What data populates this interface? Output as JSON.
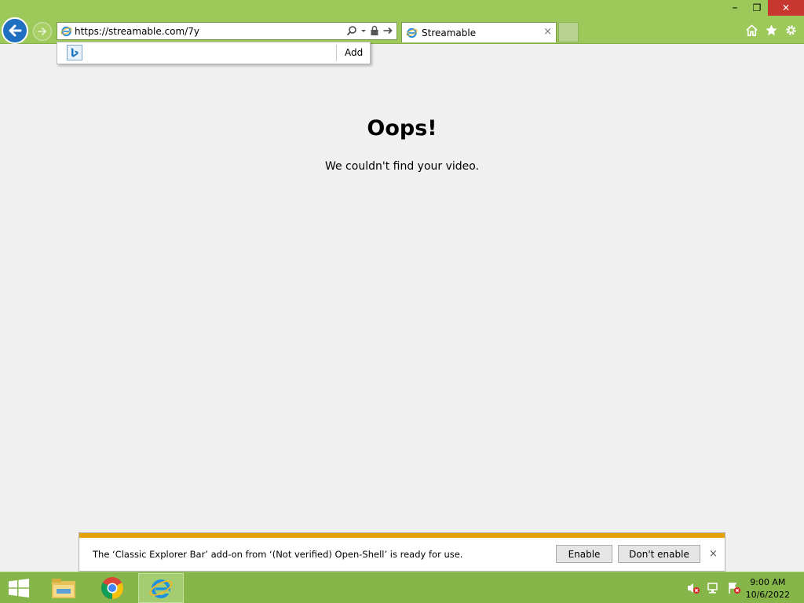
{
  "browser": {
    "address_url": "https://streamable.com/7y",
    "tab_title": "Streamable",
    "tab_close_glyph": "×",
    "suggest_add_label": "Add",
    "icons": [
      "back-icon",
      "forward-icon",
      "ie-icon",
      "search-icon",
      "lock-icon",
      "go-icon",
      "home-icon",
      "favorites-star-icon",
      "settings-gear-icon",
      "bing-icon"
    ]
  },
  "window": {
    "minimize_glyph": "–",
    "restore_glyph": "❐",
    "close_glyph": "✕"
  },
  "content": {
    "heading": "Oops!",
    "message": "We couldn't find your video."
  },
  "notification": {
    "text": "The ‘Classic Explorer Bar’ add-on from ‘(Not verified) Open-Shell’ is ready for use.",
    "enable_label": "Enable",
    "dont_enable_label": "Don't enable",
    "close_glyph": "×"
  },
  "taskbar": {
    "apps": [
      "file-explorer",
      "chrome",
      "internet-explorer"
    ],
    "time": "9:00 AM",
    "date": "10/6/2022"
  },
  "colors": {
    "chrome_green": "#9dc85a",
    "taskbar_green": "#86b54a",
    "back_blue": "#1f70c1",
    "notification_stripe": "#e3a20b",
    "close_red": "#c7362f"
  }
}
